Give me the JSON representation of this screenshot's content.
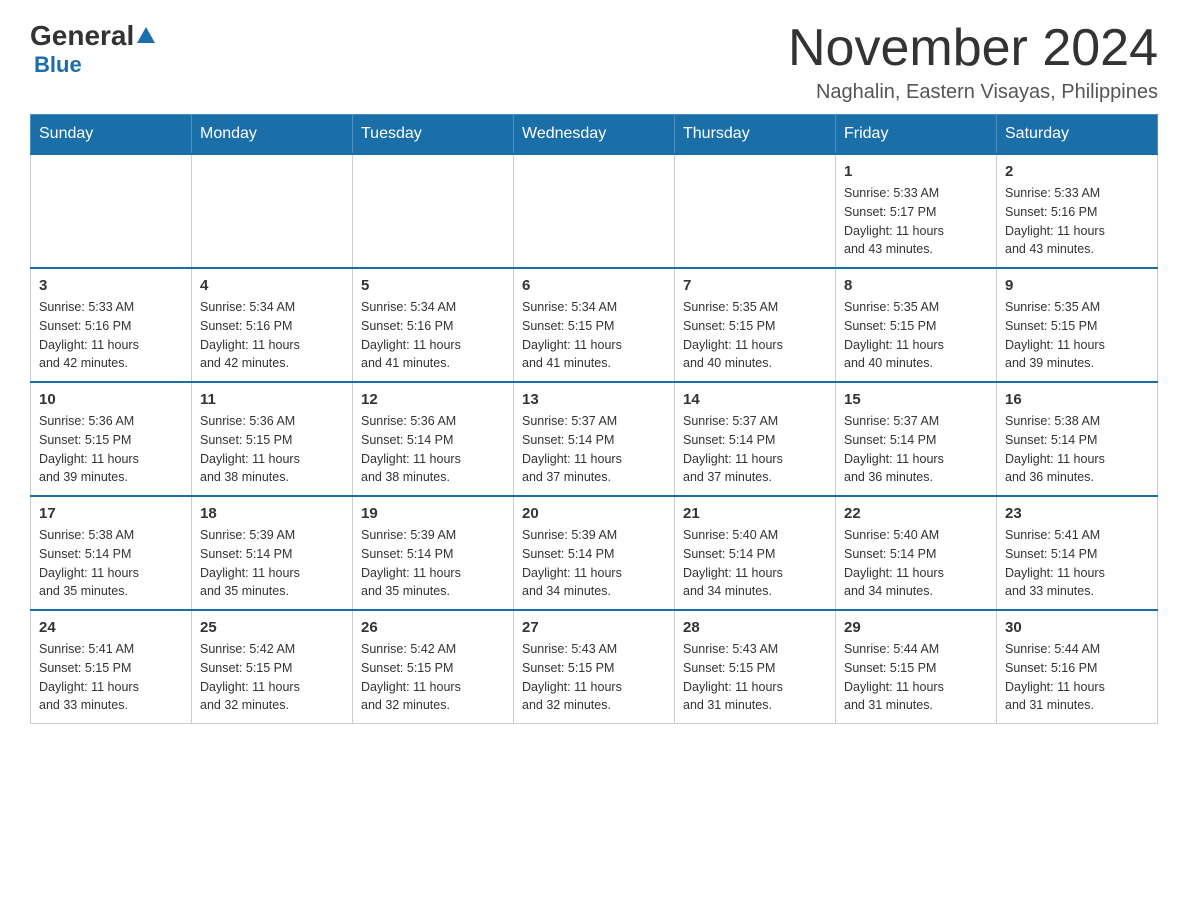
{
  "header": {
    "logo_general": "General",
    "logo_blue": "Blue",
    "month_title": "November 2024",
    "location": "Naghalin, Eastern Visayas, Philippines"
  },
  "weekdays": [
    "Sunday",
    "Monday",
    "Tuesday",
    "Wednesday",
    "Thursday",
    "Friday",
    "Saturday"
  ],
  "weeks": [
    [
      {
        "day": "",
        "info": ""
      },
      {
        "day": "",
        "info": ""
      },
      {
        "day": "",
        "info": ""
      },
      {
        "day": "",
        "info": ""
      },
      {
        "day": "",
        "info": ""
      },
      {
        "day": "1",
        "info": "Sunrise: 5:33 AM\nSunset: 5:17 PM\nDaylight: 11 hours\nand 43 minutes."
      },
      {
        "day": "2",
        "info": "Sunrise: 5:33 AM\nSunset: 5:16 PM\nDaylight: 11 hours\nand 43 minutes."
      }
    ],
    [
      {
        "day": "3",
        "info": "Sunrise: 5:33 AM\nSunset: 5:16 PM\nDaylight: 11 hours\nand 42 minutes."
      },
      {
        "day": "4",
        "info": "Sunrise: 5:34 AM\nSunset: 5:16 PM\nDaylight: 11 hours\nand 42 minutes."
      },
      {
        "day": "5",
        "info": "Sunrise: 5:34 AM\nSunset: 5:16 PM\nDaylight: 11 hours\nand 41 minutes."
      },
      {
        "day": "6",
        "info": "Sunrise: 5:34 AM\nSunset: 5:15 PM\nDaylight: 11 hours\nand 41 minutes."
      },
      {
        "day": "7",
        "info": "Sunrise: 5:35 AM\nSunset: 5:15 PM\nDaylight: 11 hours\nand 40 minutes."
      },
      {
        "day": "8",
        "info": "Sunrise: 5:35 AM\nSunset: 5:15 PM\nDaylight: 11 hours\nand 40 minutes."
      },
      {
        "day": "9",
        "info": "Sunrise: 5:35 AM\nSunset: 5:15 PM\nDaylight: 11 hours\nand 39 minutes."
      }
    ],
    [
      {
        "day": "10",
        "info": "Sunrise: 5:36 AM\nSunset: 5:15 PM\nDaylight: 11 hours\nand 39 minutes."
      },
      {
        "day": "11",
        "info": "Sunrise: 5:36 AM\nSunset: 5:15 PM\nDaylight: 11 hours\nand 38 minutes."
      },
      {
        "day": "12",
        "info": "Sunrise: 5:36 AM\nSunset: 5:14 PM\nDaylight: 11 hours\nand 38 minutes."
      },
      {
        "day": "13",
        "info": "Sunrise: 5:37 AM\nSunset: 5:14 PM\nDaylight: 11 hours\nand 37 minutes."
      },
      {
        "day": "14",
        "info": "Sunrise: 5:37 AM\nSunset: 5:14 PM\nDaylight: 11 hours\nand 37 minutes."
      },
      {
        "day": "15",
        "info": "Sunrise: 5:37 AM\nSunset: 5:14 PM\nDaylight: 11 hours\nand 36 minutes."
      },
      {
        "day": "16",
        "info": "Sunrise: 5:38 AM\nSunset: 5:14 PM\nDaylight: 11 hours\nand 36 minutes."
      }
    ],
    [
      {
        "day": "17",
        "info": "Sunrise: 5:38 AM\nSunset: 5:14 PM\nDaylight: 11 hours\nand 35 minutes."
      },
      {
        "day": "18",
        "info": "Sunrise: 5:39 AM\nSunset: 5:14 PM\nDaylight: 11 hours\nand 35 minutes."
      },
      {
        "day": "19",
        "info": "Sunrise: 5:39 AM\nSunset: 5:14 PM\nDaylight: 11 hours\nand 35 minutes."
      },
      {
        "day": "20",
        "info": "Sunrise: 5:39 AM\nSunset: 5:14 PM\nDaylight: 11 hours\nand 34 minutes."
      },
      {
        "day": "21",
        "info": "Sunrise: 5:40 AM\nSunset: 5:14 PM\nDaylight: 11 hours\nand 34 minutes."
      },
      {
        "day": "22",
        "info": "Sunrise: 5:40 AM\nSunset: 5:14 PM\nDaylight: 11 hours\nand 34 minutes."
      },
      {
        "day": "23",
        "info": "Sunrise: 5:41 AM\nSunset: 5:14 PM\nDaylight: 11 hours\nand 33 minutes."
      }
    ],
    [
      {
        "day": "24",
        "info": "Sunrise: 5:41 AM\nSunset: 5:15 PM\nDaylight: 11 hours\nand 33 minutes."
      },
      {
        "day": "25",
        "info": "Sunrise: 5:42 AM\nSunset: 5:15 PM\nDaylight: 11 hours\nand 32 minutes."
      },
      {
        "day": "26",
        "info": "Sunrise: 5:42 AM\nSunset: 5:15 PM\nDaylight: 11 hours\nand 32 minutes."
      },
      {
        "day": "27",
        "info": "Sunrise: 5:43 AM\nSunset: 5:15 PM\nDaylight: 11 hours\nand 32 minutes."
      },
      {
        "day": "28",
        "info": "Sunrise: 5:43 AM\nSunset: 5:15 PM\nDaylight: 11 hours\nand 31 minutes."
      },
      {
        "day": "29",
        "info": "Sunrise: 5:44 AM\nSunset: 5:15 PM\nDaylight: 11 hours\nand 31 minutes."
      },
      {
        "day": "30",
        "info": "Sunrise: 5:44 AM\nSunset: 5:16 PM\nDaylight: 11 hours\nand 31 minutes."
      }
    ]
  ]
}
